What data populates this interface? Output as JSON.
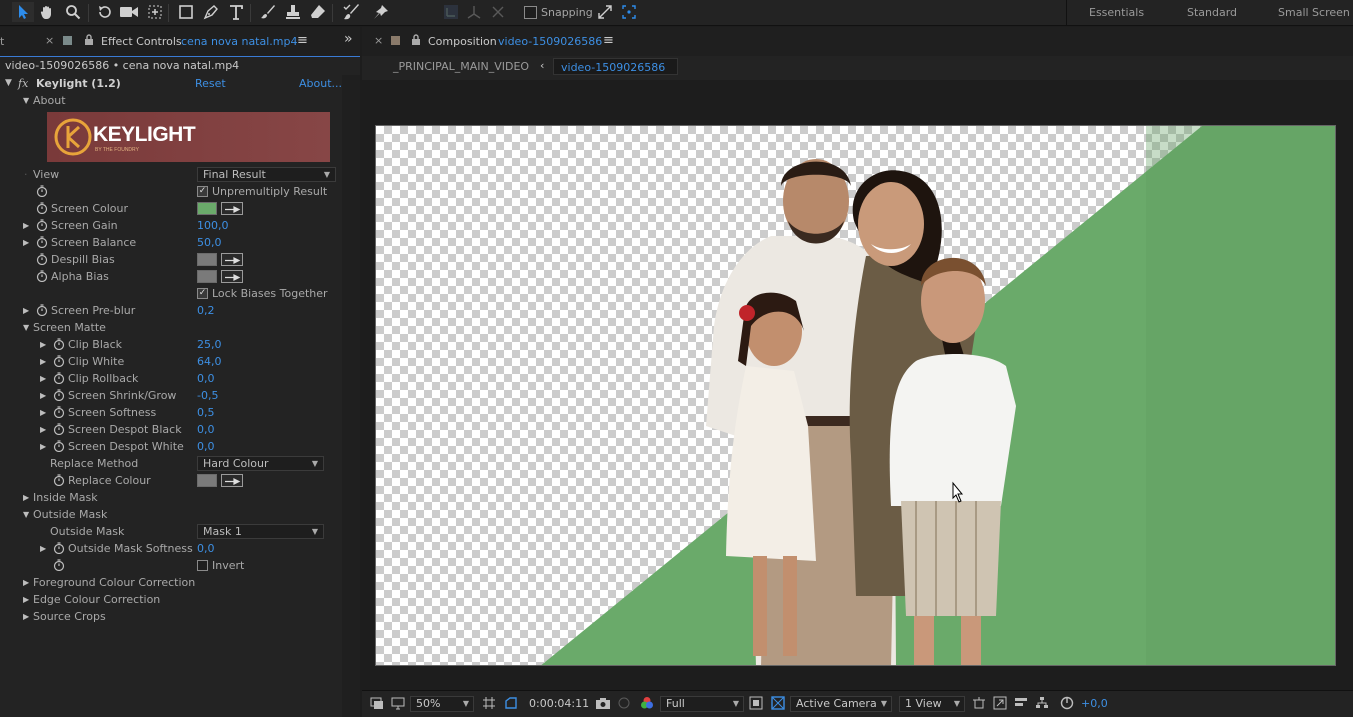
{
  "toolbar": {
    "snapping_label": "Snapping",
    "workspaces": [
      "Essentials",
      "Standard",
      "Small Screen"
    ]
  },
  "effect_panel": {
    "tab_title_prefix": "Effect Controls",
    "tab_title_file": "cena nova natal.mp4",
    "partial_tab": "t",
    "breadcrumb": "video-1509026586 • cena nova natal.mp4",
    "effect_name": "Keylight (1.2)",
    "reset_label": "Reset",
    "about_link": "About...",
    "about_section": "About",
    "logo_text": "KEYLIGHT",
    "logo_subtext": "BY THE FOUNDRY",
    "view_label": "View",
    "view_value": "Final Result",
    "unpremultiply_label": "Unpremultiply Result",
    "screen_colour_label": "Screen Colour",
    "screen_colour": "#6aaa6a",
    "screen_gain_label": "Screen Gain",
    "screen_gain": "100,0",
    "screen_balance_label": "Screen Balance",
    "screen_balance": "50,0",
    "despill_bias_label": "Despill Bias",
    "alpha_bias_label": "Alpha Bias",
    "bias_swatch": "#7a7a7a",
    "lock_biases_label": "Lock Biases Together",
    "screen_preblur_label": "Screen Pre-blur",
    "screen_preblur": "0,2",
    "screen_matte_label": "Screen Matte",
    "clip_black_label": "Clip Black",
    "clip_black": "25,0",
    "clip_white_label": "Clip White",
    "clip_white": "64,0",
    "clip_rollback_label": "Clip Rollback",
    "clip_rollback": "0,0",
    "shrink_grow_label": "Screen Shrink/Grow",
    "shrink_grow": "-0,5",
    "softness_label": "Screen Softness",
    "softness": "0,5",
    "despot_black_label": "Screen Despot Black",
    "despot_black": "0,0",
    "despot_white_label": "Screen Despot White",
    "despot_white": "0,0",
    "replace_method_label": "Replace Method",
    "replace_method": "Hard Colour",
    "replace_colour_label": "Replace Colour",
    "inside_mask_label": "Inside Mask",
    "outside_mask_section": "Outside Mask",
    "outside_mask_label": "Outside Mask",
    "outside_mask_value": "Mask 1",
    "outside_mask_softness_label": "Outside Mask Softness",
    "outside_mask_softness": "0,0",
    "invert_label": "Invert",
    "fg_colour_label": "Foreground Colour Correction",
    "edge_colour_label": "Edge Colour Correction",
    "source_crops_label": "Source Crops"
  },
  "composition_panel": {
    "tab_prefix": "Composition",
    "tab_name": "video-1509026586",
    "nav_parent": "_PRINCIPAL_MAIN_VIDEO",
    "nav_current": "video-1509026586",
    "zoom": "50%",
    "timecode": "0:00:04:11",
    "resolution": "Full",
    "camera": "Active Camera",
    "views": "1 View",
    "exposure": "+0,0"
  },
  "colors": {
    "accent_blue": "#3d8fe3",
    "green_screen": "#6aaa6a",
    "logo_bg": "#7a3a3a",
    "logo_ring": "#e8a43a"
  }
}
